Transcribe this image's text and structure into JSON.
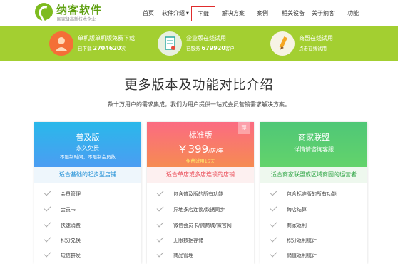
{
  "brand": {
    "title": "纳客软件",
    "subtitle": "国家级高新技术企业"
  },
  "nav": {
    "items": [
      "首页",
      "软件介绍",
      "下载",
      "解决方案",
      "案例",
      "相关设备",
      "关于纳客",
      "功能"
    ],
    "active_index": 2,
    "has_dropdown_index": 1
  },
  "promos": [
    {
      "title": "单机版单机版免费下载",
      "sub_prefix": "已下载",
      "count": "2704620",
      "sub_suffix": "次",
      "icon": "user-avatar-icon"
    },
    {
      "title": "企业版在线试用",
      "sub_prefix": "已服务",
      "count": "679920",
      "sub_suffix": "客户",
      "icon": "document-icon"
    },
    {
      "title": "商盟在线试用",
      "sub_prefix": "",
      "count": "",
      "sub_suffix": "点击在线试用",
      "icon": "pencil-icon"
    }
  ],
  "heading": {
    "title": "更多版本及功能对比介绍",
    "subtitle": "数十万用户的需求集成，我们为用户提供一站式会员营销需求解决方案。"
  },
  "plans": [
    {
      "name": "普及版",
      "line1": "永久免费",
      "line2a": "不限制时间，不限制会员数",
      "audience": "适合基础的起步型店铺",
      "features": [
        "会员管理",
        "会员卡",
        "快速消费",
        "积分兑换",
        "短信群发"
      ],
      "color_top": "#29b3ec",
      "color_bottom": "#4ea1f2",
      "audience_color": "#1f8fd6"
    },
    {
      "name": "标准版",
      "price": "￥399",
      "price_unit": "/店/年",
      "line2a": "免费试用15天",
      "badge": "荐",
      "audience": "适合单店或多店连锁的店铺",
      "features": [
        "包含普及版的所有功能",
        "异地多店连锁/数据同步",
        "微信会员卡/微商城/微官网",
        "无限数据存储",
        "商品管理"
      ],
      "color_top": "#fa6f7f",
      "color_bottom": "#f68a55",
      "audience_color": "#ea4c57"
    },
    {
      "name": "商家联盟",
      "line1": "详情请咨询客服",
      "audience": "适合商家联盟或区域商圈的运营者",
      "features": [
        "包含标准版的所有功能",
        "跨店结算",
        "商家返利",
        "积分返利统计",
        "储值返利统计"
      ],
      "color_top": "#51c774",
      "color_bottom": "#60d26c",
      "audience_color": "#35a84a"
    }
  ],
  "colors": {
    "band": "#a3cf31",
    "brand_green": "#5ea010",
    "nav_active_border": "#e02c2c"
  }
}
